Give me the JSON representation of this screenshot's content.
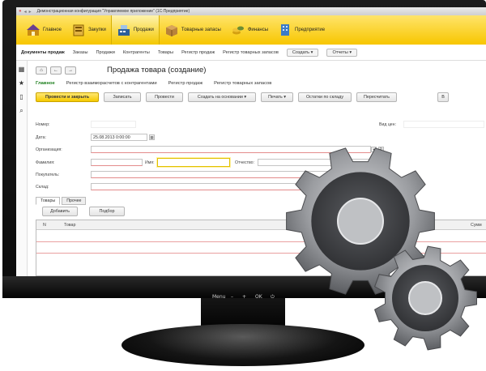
{
  "window": {
    "title": "Демонстрационная конфигурация \"Управляемое приложение\" (1С:Предприятие)"
  },
  "sections": [
    {
      "label": "Главное",
      "icon": "home-icon"
    },
    {
      "label": "Закупки",
      "icon": "purchases-icon"
    },
    {
      "label": "Продажи",
      "icon": "cash-register-icon"
    },
    {
      "label": "Товарные запасы",
      "icon": "box-icon"
    },
    {
      "label": "Финансы",
      "icon": "coins-icon"
    },
    {
      "label": "Предприятие",
      "icon": "enterprise-icon"
    }
  ],
  "nav": {
    "items": [
      "Документы продаж",
      "Заказы",
      "Продажи",
      "Контрагенты",
      "Товары",
      "Регистр продаж",
      "Регистр товарных запасов"
    ],
    "create": "Создать ▾",
    "reports": "Отчеты ▾"
  },
  "form": {
    "title": "Продажа товара (создание)",
    "tabs": [
      "Главное",
      "Регистр взаиморасчетов с контрагентами",
      "Регистр продаж",
      "Регистр товарных запасов"
    ],
    "toolbar": {
      "post_close": "Провести и закрыть",
      "save": "Записать",
      "post": "Провести",
      "create_based": "Создать на основании ▾",
      "print": "Печать ▾",
      "stock": "Остатки по складу",
      "recalc": "Пересчитать",
      "more": "В"
    },
    "labels": {
      "number": "Номер:",
      "date": "Дата:",
      "organization": "Организация:",
      "surname": "Фамилия:",
      "name": "Имя:",
      "patronymic": "Отчество:",
      "buyer": "Покупатель:",
      "warehouse": "Склад:",
      "price_type": "Вид цен:"
    },
    "values": {
      "date": "25.08.2013  0:00:00"
    },
    "subtabs": [
      "Товары",
      "Прочее"
    ],
    "table": {
      "add": "Добавить",
      "select": "Подбор",
      "columns": [
        "N",
        "Товар",
        "Цена",
        "Сумм"
      ]
    }
  },
  "monitor": {
    "buttons": [
      "Menu",
      "–",
      "+",
      "OK",
      "⏻"
    ]
  },
  "colors": {
    "accent": "#f7c600",
    "green_tab": "#1d7f1d",
    "gear": "#8d8f93"
  }
}
